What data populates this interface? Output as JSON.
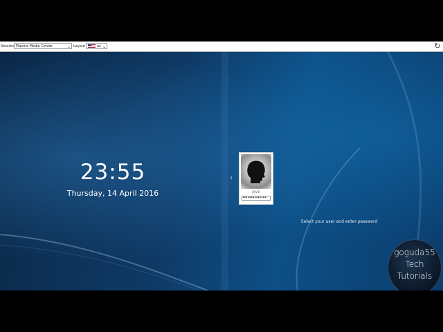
{
  "session": {
    "label": "Session:",
    "value": "Plasma Media Center"
  },
  "layout": {
    "label": "Layout",
    "value": "us"
  },
  "clock": {
    "time": "23:55",
    "date": "Thursday, 14 April 2016"
  },
  "user": {
    "name": "DAVID",
    "password_mask": "••••••••••••••"
  },
  "hint": "Select your user and enter password",
  "watermark": {
    "line1": "goguda55",
    "line2": "Tech",
    "line3": "Tutorials"
  },
  "icons": {
    "prev": "chevron-left-icon",
    "reload": "reload-icon",
    "flag": "us-flag-icon",
    "avatar": "user-silhouette-icon"
  }
}
